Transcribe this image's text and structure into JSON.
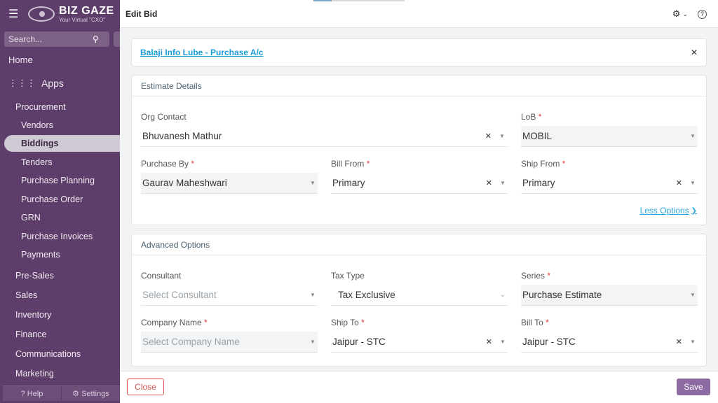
{
  "sidebar": {
    "brand_name": "BIZ GAZE",
    "brand_tagline": "Your Virtual \"CXO\"",
    "search_placeholder": "Search...",
    "home": "Home",
    "apps": "Apps",
    "procurement": "Procurement",
    "procurement_items": [
      "Vendors",
      "Biddings",
      "Tenders",
      "Purchase Planning",
      "Purchase Order",
      "GRN",
      "Purchase Invoices",
      "Payments"
    ],
    "groups": [
      "Pre-Sales",
      "Sales",
      "Inventory",
      "Finance",
      "Communications",
      "Marketing"
    ],
    "help": "Help",
    "settings": "Settings"
  },
  "header": {
    "title": "Edit Bid"
  },
  "link_card": {
    "link_text": "Balaji Info Lube - Purchase A/c"
  },
  "estimate": {
    "title": "Estimate Details",
    "org_contact_label": "Org Contact",
    "org_contact_value": "Bhuvanesh Mathur",
    "lob_label": "LoB",
    "lob_value": "MOBIL",
    "purchase_by_label": "Purchase By",
    "purchase_by_value": "Gaurav Maheshwari",
    "bill_from_label": "Bill From",
    "bill_from_value": "Primary",
    "ship_from_label": "Ship From",
    "ship_from_value": "Primary",
    "less_options": "Less Options"
  },
  "advanced": {
    "title": "Advanced Options",
    "consultant_label": "Consultant",
    "consultant_placeholder": "Select Consultant",
    "tax_type_label": "Tax Type",
    "tax_type_value": "Tax Exclusive",
    "series_label": "Series",
    "series_value": "Purchase Estimate",
    "company_label": "Company Name",
    "company_placeholder": "Select Company Name",
    "ship_to_label": "Ship To",
    "ship_to_value": "Jaipur - STC",
    "bill_to_label": "Bill To",
    "bill_to_value": "Jaipur - STC"
  },
  "footer": {
    "close_label": "Close",
    "save_label": "Save"
  },
  "required_mark": "*"
}
